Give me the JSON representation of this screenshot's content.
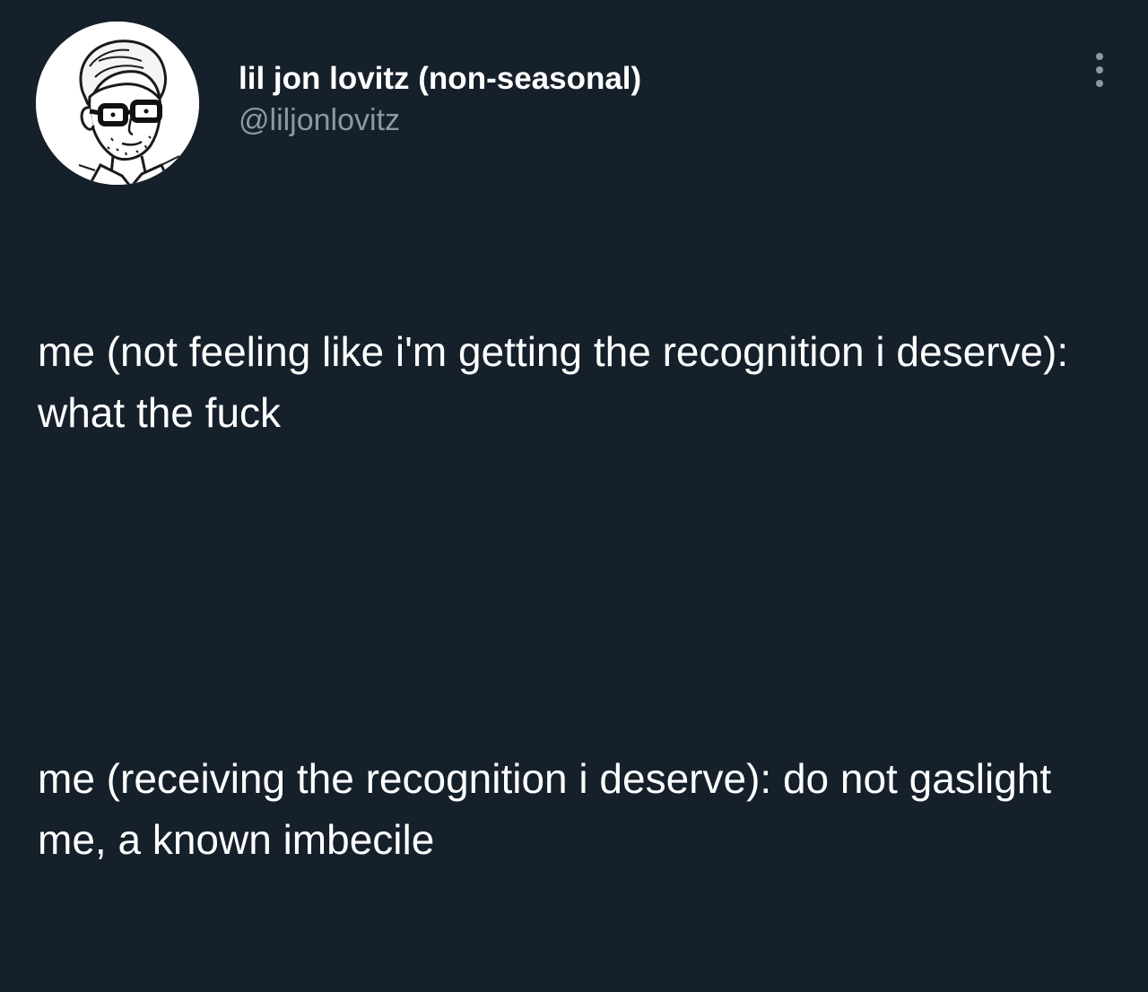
{
  "author": {
    "display_name": "lil jon lovitz (non-seasonal)",
    "handle": "@liljonlovitz",
    "avatar_icon": "cartoon-man-with-glasses-avatar"
  },
  "menu": {
    "icon": "more-options-icon"
  },
  "tweet": {
    "paragraphs": [
      "me (not feeling like i'm getting the recognition i deserve): what the fuck",
      "me (receiving the recognition i deserve): do not gaslight me, a known imbecile"
    ]
  },
  "colors": {
    "background": "#15202b",
    "primary_text": "#ffffff",
    "secondary_text": "#8b98a5"
  }
}
